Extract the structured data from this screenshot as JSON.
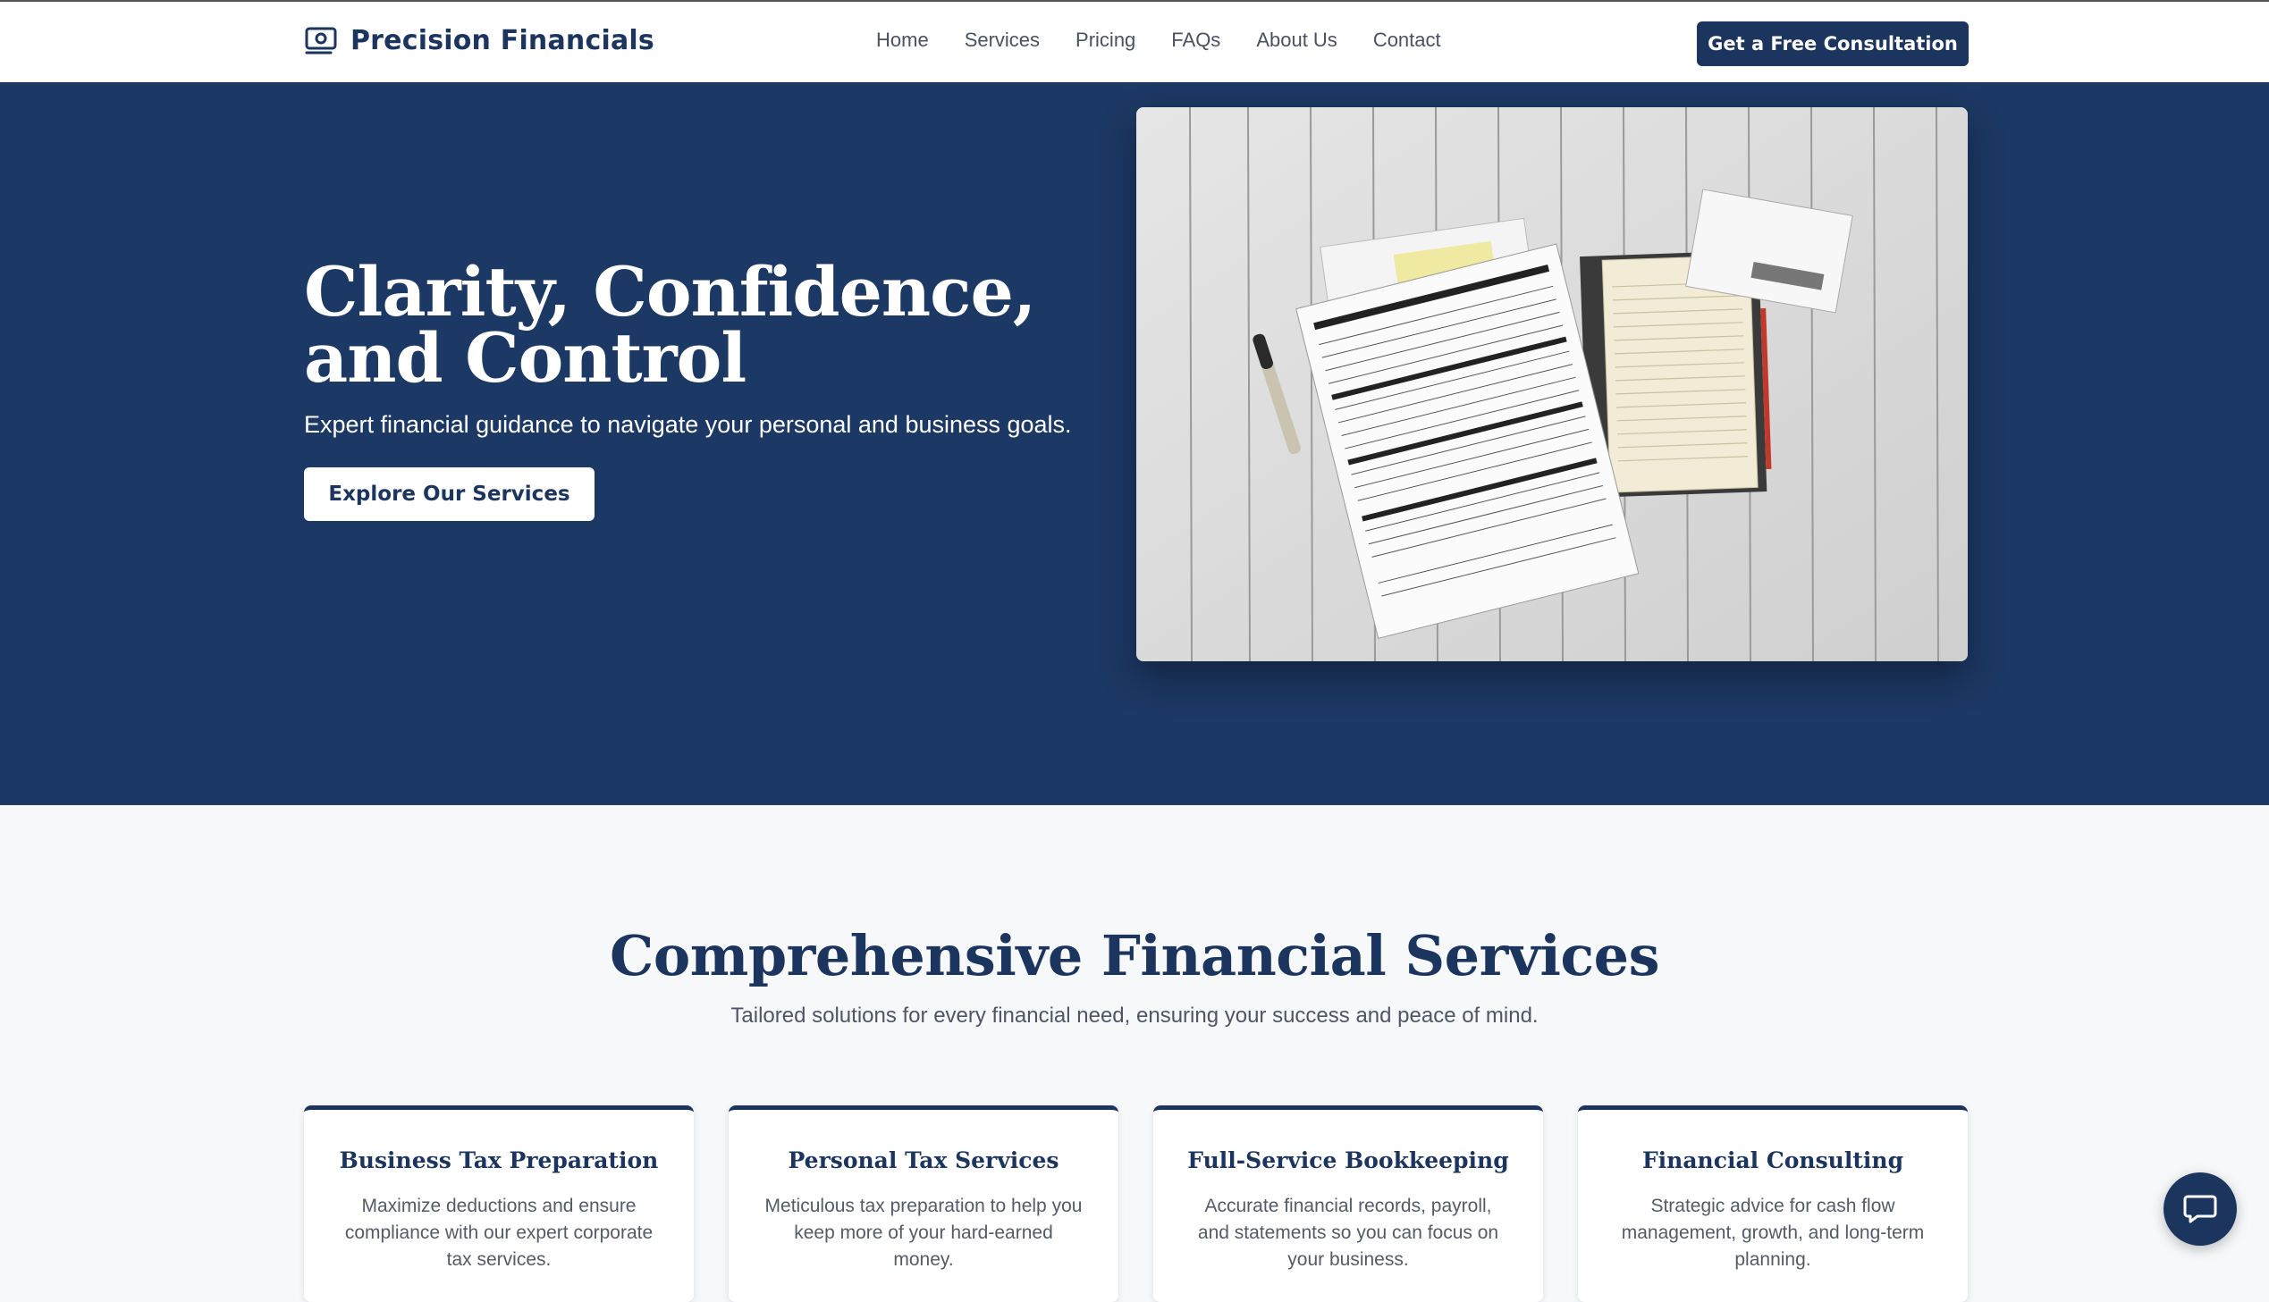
{
  "brand": {
    "name": "Precision Financials",
    "icon": "money-bill-icon"
  },
  "nav": {
    "links": [
      "Home",
      "Services",
      "Pricing",
      "FAQs",
      "About Us",
      "Contact"
    ],
    "cta_label": "Get a Free Consultation"
  },
  "hero": {
    "title": "Clarity, Confidence, and Control",
    "subtitle": "Expert financial guidance to navigate your personal and business goals.",
    "button_label": "Explore Our Services",
    "image_alt": "tax forms, notebook and pen on white wooden table"
  },
  "services": {
    "title": "Comprehensive Financial Services",
    "subtitle": "Tailored solutions for every financial need, ensuring your success and peace of mind.",
    "cards": [
      {
        "title": "Business Tax Preparation",
        "description": "Maximize deductions and ensure compliance with our expert corporate tax services."
      },
      {
        "title": "Personal Tax Services",
        "description": "Meticulous tax preparation to help you keep more of your hard-earned money."
      },
      {
        "title": "Full-Service Bookkeeping",
        "description": "Accurate financial records, payroll, and statements so you can focus on your business."
      },
      {
        "title": "Financial Consulting",
        "description": "Strategic advice for cash flow management, growth, and long-term planning."
      }
    ]
  },
  "chat": {
    "icon": "chat-bubble-icon"
  },
  "colors": {
    "primary": "#1c355e",
    "hero_bg": "#1c3864",
    "page_bg": "#f7f8fa"
  }
}
